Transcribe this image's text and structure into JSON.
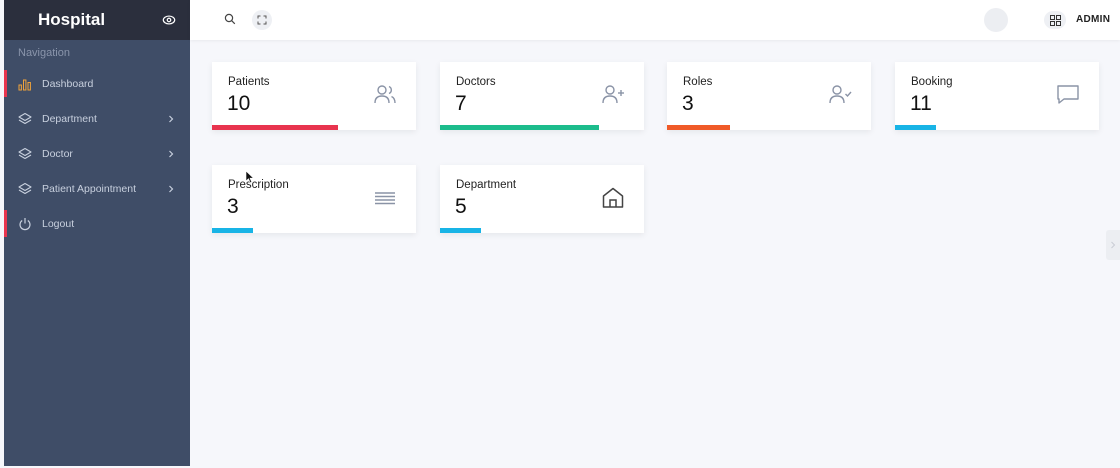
{
  "sidebar": {
    "brand": "Hospital",
    "toggle_icon": "eye-toggle-icon",
    "nav_caption": "Navigation",
    "items": [
      {
        "label": "Dashboard",
        "icon": "bar-chart-icon",
        "has_chevron": false
      },
      {
        "label": "Department",
        "icon": "layers-icon",
        "has_chevron": true
      },
      {
        "label": "Doctor",
        "icon": "layers-icon",
        "has_chevron": true
      },
      {
        "label": "Patient Appointment",
        "icon": "layers-icon",
        "has_chevron": true
      },
      {
        "label": "Logout",
        "icon": "power-icon",
        "has_chevron": false
      }
    ]
  },
  "topbar": {
    "user_label": "ADMIN",
    "icons": [
      "search-icon",
      "fullscreen-icon",
      "avatar",
      "grid-icon"
    ]
  },
  "cards": [
    {
      "label": "Patients",
      "value": "10",
      "icon": "users-icon",
      "bar_color": "#e8344e",
      "bar_fraction": 0.62
    },
    {
      "label": "Doctors",
      "value": "7",
      "icon": "user-plus-icon",
      "bar_color": "#1cbc8c",
      "bar_fraction": 0.78
    },
    {
      "label": "Roles",
      "value": "3",
      "icon": "user-check-icon",
      "bar_color": "#f05a28",
      "bar_fraction": 0.31
    },
    {
      "label": "Booking",
      "value": "11",
      "icon": "message-square-icon",
      "bar_color": "#18b4e6",
      "bar_fraction": 0.2
    },
    {
      "label": "Prescription",
      "value": "3",
      "icon": "align-justify-icon",
      "bar_color": "#18b4e6",
      "bar_fraction": 0.2
    },
    {
      "label": "Department",
      "value": "5",
      "icon": "home-icon",
      "bar_color": "#18b4e6",
      "bar_fraction": 0.2
    }
  ],
  "colors": {
    "sidebar_bg": "#3f4d67",
    "brand_bg": "#2b2f3d",
    "accent_red": "#e8344e"
  }
}
